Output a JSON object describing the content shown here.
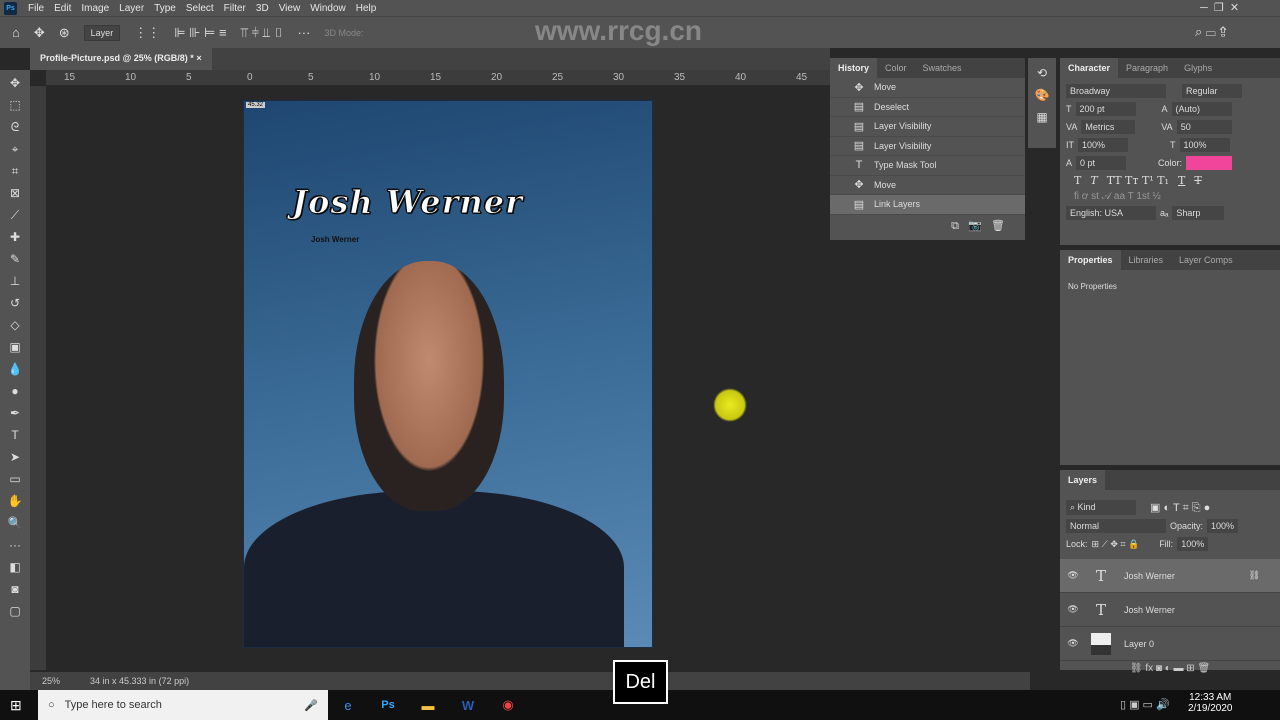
{
  "menu": [
    "File",
    "Edit",
    "Image",
    "Layer",
    "Type",
    "Select",
    "Filter",
    "3D",
    "View",
    "Window",
    "Help"
  ],
  "options": {
    "auto_select": "Layer",
    "mode_3d": "3D Mode:"
  },
  "document_tab": "Profile-Picture.psd @ 25% (RGB/8) *",
  "ruler_ticks": [
    "15",
    "10",
    "5",
    "0",
    "5",
    "10",
    "15",
    "20",
    "25",
    "30",
    "35",
    "40",
    "45"
  ],
  "canvas": {
    "title_text": "Josh Werner",
    "small_text": "Josh Werner",
    "corner_label": "45.32"
  },
  "history": {
    "tabs": [
      "History",
      "Color",
      "Swatches"
    ],
    "items": [
      {
        "icon": "move-icon",
        "label": "Move"
      },
      {
        "icon": "doc-icon",
        "label": "Deselect"
      },
      {
        "icon": "doc-icon",
        "label": "Layer Visibility"
      },
      {
        "icon": "doc-icon",
        "label": "Layer Visibility"
      },
      {
        "icon": "type-icon",
        "label": "Type Mask Tool"
      },
      {
        "icon": "move-icon",
        "label": "Move"
      },
      {
        "icon": "doc-icon",
        "label": "Link Layers"
      }
    ]
  },
  "character": {
    "tabs": [
      "Character",
      "Paragraph",
      "Glyphs"
    ],
    "font": "Broadway",
    "style": "Regular",
    "size": "200 pt",
    "leading": "(Auto)",
    "kerning": "Metrics",
    "tracking": "50",
    "vscale": "100%",
    "hscale": "100%",
    "baseline": "0 pt",
    "color_label": "Color:",
    "color": "#f0459a",
    "language": "English: USA",
    "antialias": "Sharp"
  },
  "properties": {
    "tabs": [
      "Properties",
      "Libraries",
      "Layer Comps"
    ],
    "empty": "No Properties"
  },
  "layers": {
    "tab": "Layers",
    "filter": "Kind",
    "blend": "Normal",
    "opacity_label": "Opacity:",
    "opacity": "100%",
    "lock_label": "Lock:",
    "fill_label": "Fill:",
    "fill": "100%",
    "items": [
      {
        "type": "text",
        "name": "Josh Werner",
        "selected": true,
        "linked": true
      },
      {
        "type": "text",
        "name": "Josh Werner"
      },
      {
        "type": "image",
        "name": "Layer 0"
      }
    ]
  },
  "status": {
    "zoom": "25%",
    "doc_size": "34 in x 45.333 in (72 ppi)"
  },
  "taskbar": {
    "search_placeholder": "Type here to search",
    "time": "12:33 AM",
    "date": "2/19/2020"
  },
  "overlay_key": "Del",
  "watermark": "www.rrcg.cn"
}
